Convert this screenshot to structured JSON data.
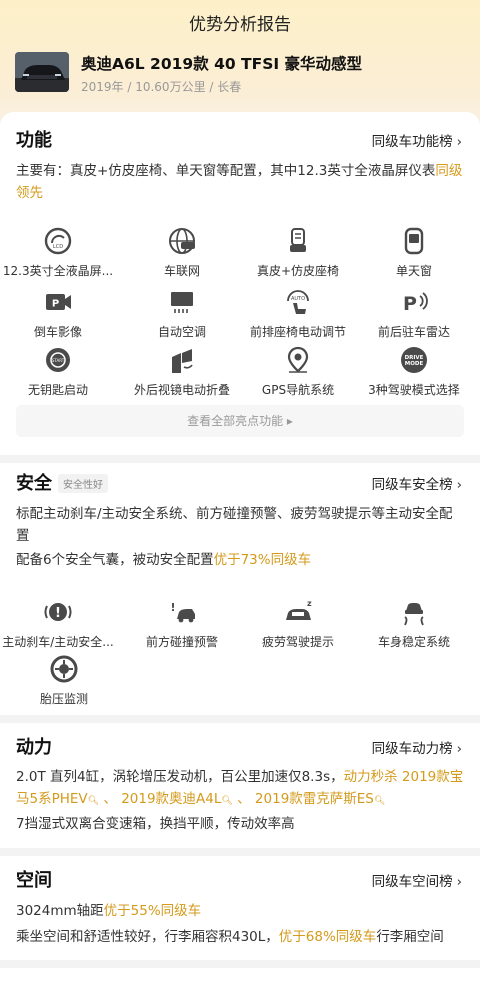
{
  "header": {
    "title": "优势分析报告"
  },
  "car": {
    "name": "奥迪A6L 2019款 40 TFSI 豪华动感型",
    "meta": "2019年 / 10.60万公里 / 长春"
  },
  "function": {
    "title": "功能",
    "rank_label": "同级车功能榜",
    "summary_prefix": "主要有：真皮+仿皮座椅、单天窗等配置，其中12.3英寸全液晶屏仪表",
    "summary_highlight": "同级领先",
    "summary_highlight_cont": "领先",
    "features": [
      {
        "label": "12.3英寸全液晶屏...",
        "icon": "lcd-gauge-icon"
      },
      {
        "label": "车联网",
        "icon": "car-network-icon"
      },
      {
        "label": "真皮+仿皮座椅",
        "icon": "seat-icon"
      },
      {
        "label": "单天窗",
        "icon": "sunroof-icon"
      },
      {
        "label": "倒车影像",
        "icon": "reverse-camera-icon"
      },
      {
        "label": "自动空调",
        "icon": "auto-ac-icon"
      },
      {
        "label": "前排座椅电动调节",
        "icon": "power-seat-icon"
      },
      {
        "label": "前后驻车雷达",
        "icon": "parking-radar-icon"
      },
      {
        "label": "无钥匙启动",
        "icon": "keyless-start-icon"
      },
      {
        "label": "外后视镜电动折叠",
        "icon": "mirror-fold-icon"
      },
      {
        "label": "GPS导航系统",
        "icon": "gps-icon"
      },
      {
        "label": "3种驾驶模式选择",
        "icon": "drive-mode-icon"
      }
    ],
    "view_all": "查看全部亮点功能 ▸"
  },
  "safety": {
    "title": "安全",
    "badge": "安全性好",
    "rank_label": "同级车安全榜",
    "line1": "标配主动刹车/主动安全系统、前方碰撞预警、疲劳驾驶提示等主动安全配置",
    "line2_prefix": "配备6个安全气囊，被动安全配置",
    "line2_highlight": "优于73%同级车",
    "features": [
      {
        "label": "主动刹车/主动安全...",
        "icon": "active-brake-icon"
      },
      {
        "label": "前方碰撞预警",
        "icon": "collision-warning-icon"
      },
      {
        "label": "疲劳驾驶提示",
        "icon": "fatigue-alert-icon"
      },
      {
        "label": "车身稳定系统",
        "icon": "stability-control-icon"
      },
      {
        "label": "胎压监测",
        "icon": "tire-pressure-icon"
      }
    ]
  },
  "power": {
    "title": "动力",
    "rank_label": "同级车动力榜",
    "line1_prefix": "2.0T 直列4缸，涡轮增压发动机，百公里加速仅8.3s，",
    "line1_highlight": "动力秒杀",
    "compare1": "2019款宝马5系PHEV",
    "sep1": "、",
    "compare2": "2019款奥迪A4L",
    "sep2": "、",
    "compare3": "2019款雷克萨斯ES",
    "line2": "7挡湿式双离合变速箱，换挡平顺，传动效率高"
  },
  "space": {
    "title": "空间",
    "rank_label": "同级车空间榜",
    "line1_prefix": "3024mm轴距",
    "line1_highlight": "优于55%同级车",
    "line2_prefix": "乘坐空间和舒适性较好，行李厢容积430L，",
    "line2_highlight": "优于68%同级车",
    "line2_suffix": "行李厢空间"
  },
  "colors": {
    "accent": "#d49a1c",
    "icon": "#4a4a4a"
  }
}
